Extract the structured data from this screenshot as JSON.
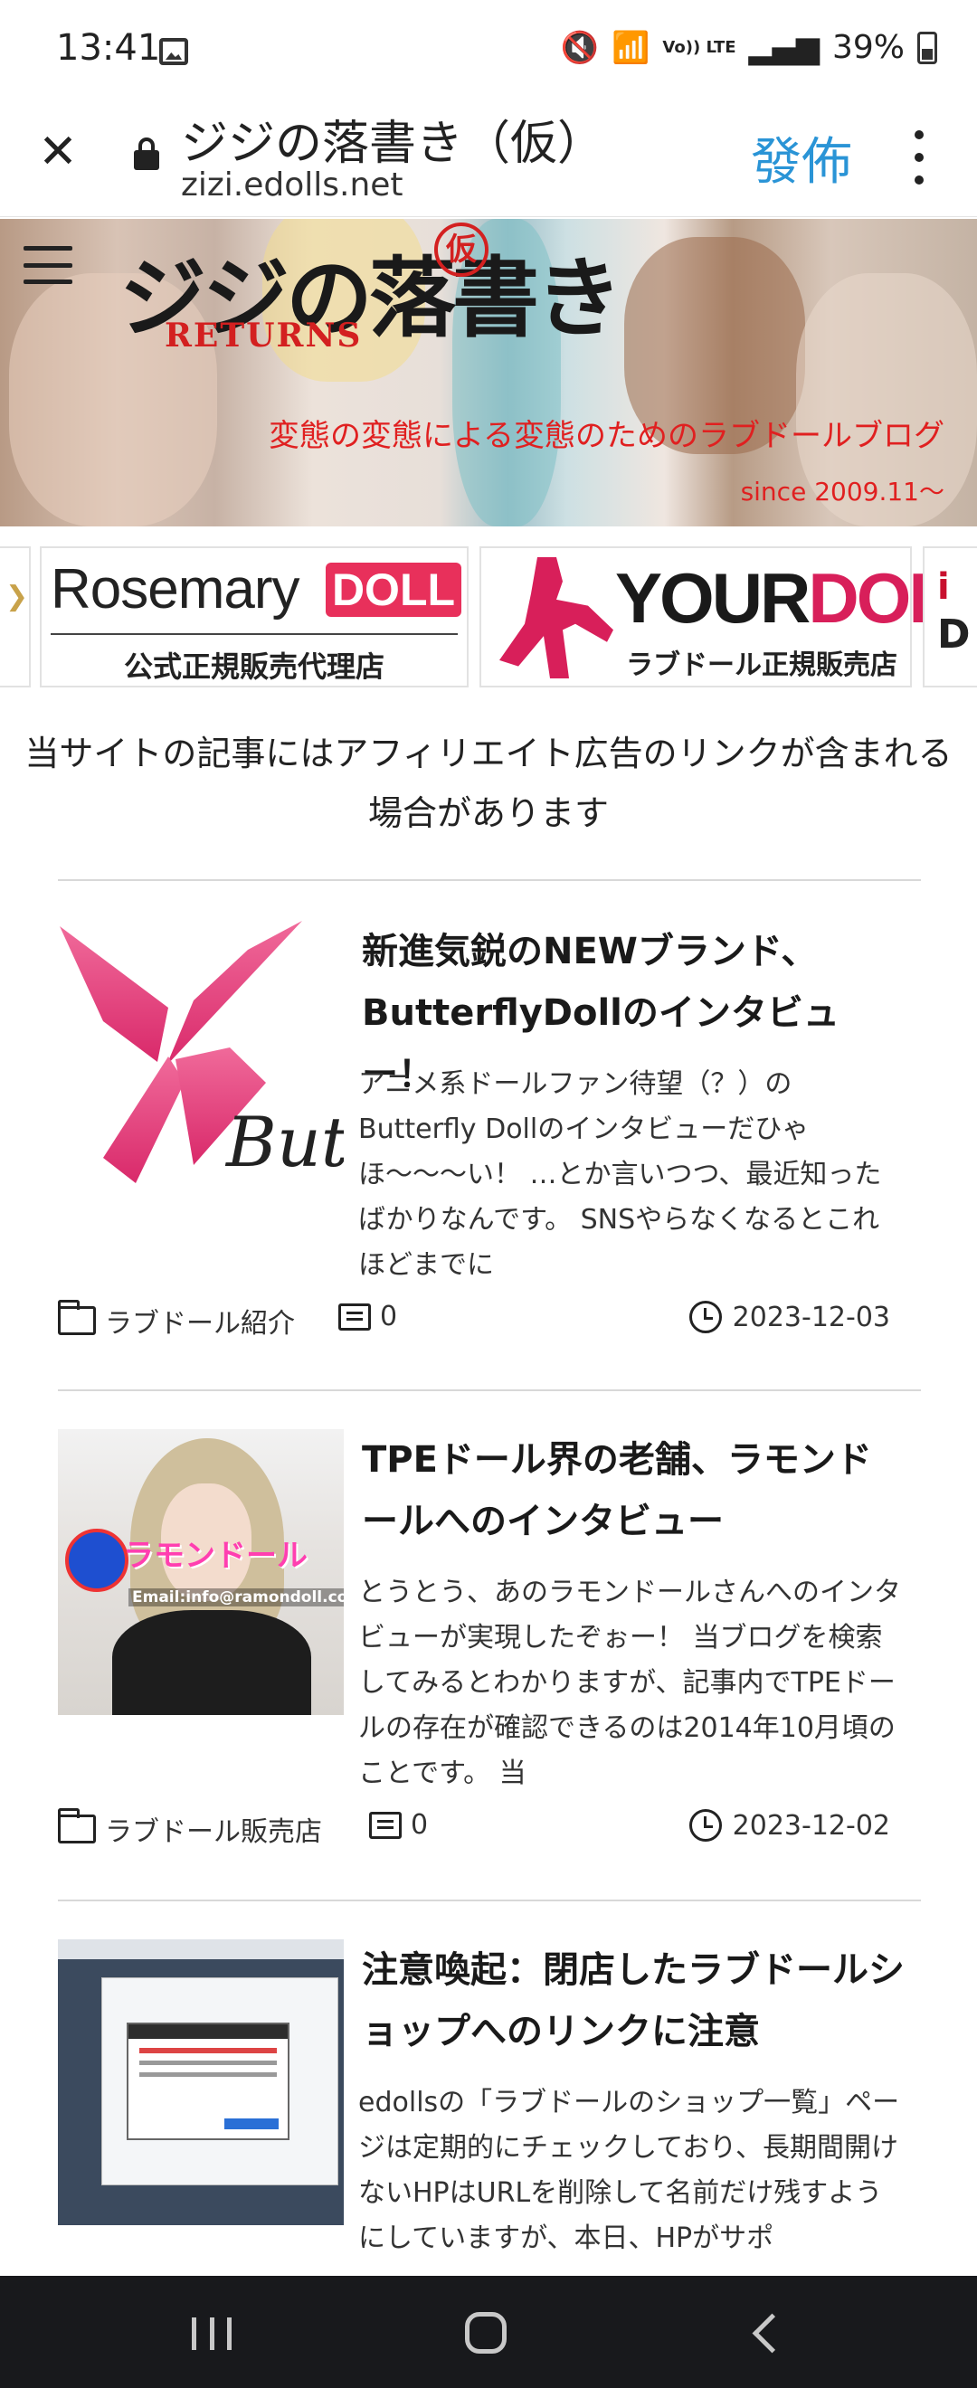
{
  "status_bar": {
    "time": "13:41",
    "volte_label": "Vo)) LTE",
    "battery": "39%",
    "icons": [
      "image-icon",
      "mute-icon",
      "wifi-icon",
      "signal-icon",
      "battery-icon"
    ]
  },
  "browser": {
    "title": "ジジの落書き（仮）",
    "url": "zizi.edolls.net",
    "translate_label": "發佈",
    "accent_color": "#2a94d6"
  },
  "header": {
    "logo_text": "ジジの落書き",
    "logo_kari": "仮",
    "logo_sub": "RETURNS",
    "tagline": "変態の変態による変態のためのラブドールブログ",
    "since": "since 2009.11〜"
  },
  "ads": {
    "rosemary": {
      "name": "Rosemary",
      "badge": "DOLL",
      "sub": "公式正規販売代理店"
    },
    "yourdoll": {
      "name_a": "YOUR",
      "name_b": "DOLL",
      "sub": "ラブドール正規販売店"
    }
  },
  "disclaimer": "当サイトの記事にはアフィリエイト広告のリンクが含まれる場合があります",
  "articles": [
    {
      "title": "新進気鋭のNEWブランド、ButterflyDollのインタビュー！",
      "thumb_text": "But",
      "excerpt": "アニメ系ドールファン待望（？）のButterfly Dollのインタビューだひゃほ〜〜〜い！ …とか言いつつ、最近知ったばかりなんです。 SNSやらなくなるとこれほどまでに",
      "category": "ラブドール紹介",
      "comments": "0",
      "date": "2023-12-03"
    },
    {
      "title": "TPEドール界の老舗、ラモンドールへのインタビュー",
      "thumb_text": "ラモンドール",
      "thumb_email": "Email:info@ramondoll.com",
      "excerpt": "とうとう、あのラモンドールさんへのインタビューが実現したぞぉー！ 当ブログを検索してみるとわかりますが、記事内でTPEドールの存在が確認できるのは2014年10月頃のことです。 当",
      "category": "ラブドール販売店",
      "comments": "0",
      "date": "2023-12-02"
    },
    {
      "title": "注意喚起：閉店したラブドールショップへのリンクに注意",
      "excerpt": "edollsの「ラブドールのショップ一覧」ページは定期的にチェックしており、長期間開けないHPはURLを削除して名前だけ残すようにしていますが、本日、HPがサポ"
    }
  ],
  "nav_bar": {
    "icons": [
      "recent-apps-icon",
      "home-icon",
      "back-icon"
    ]
  }
}
